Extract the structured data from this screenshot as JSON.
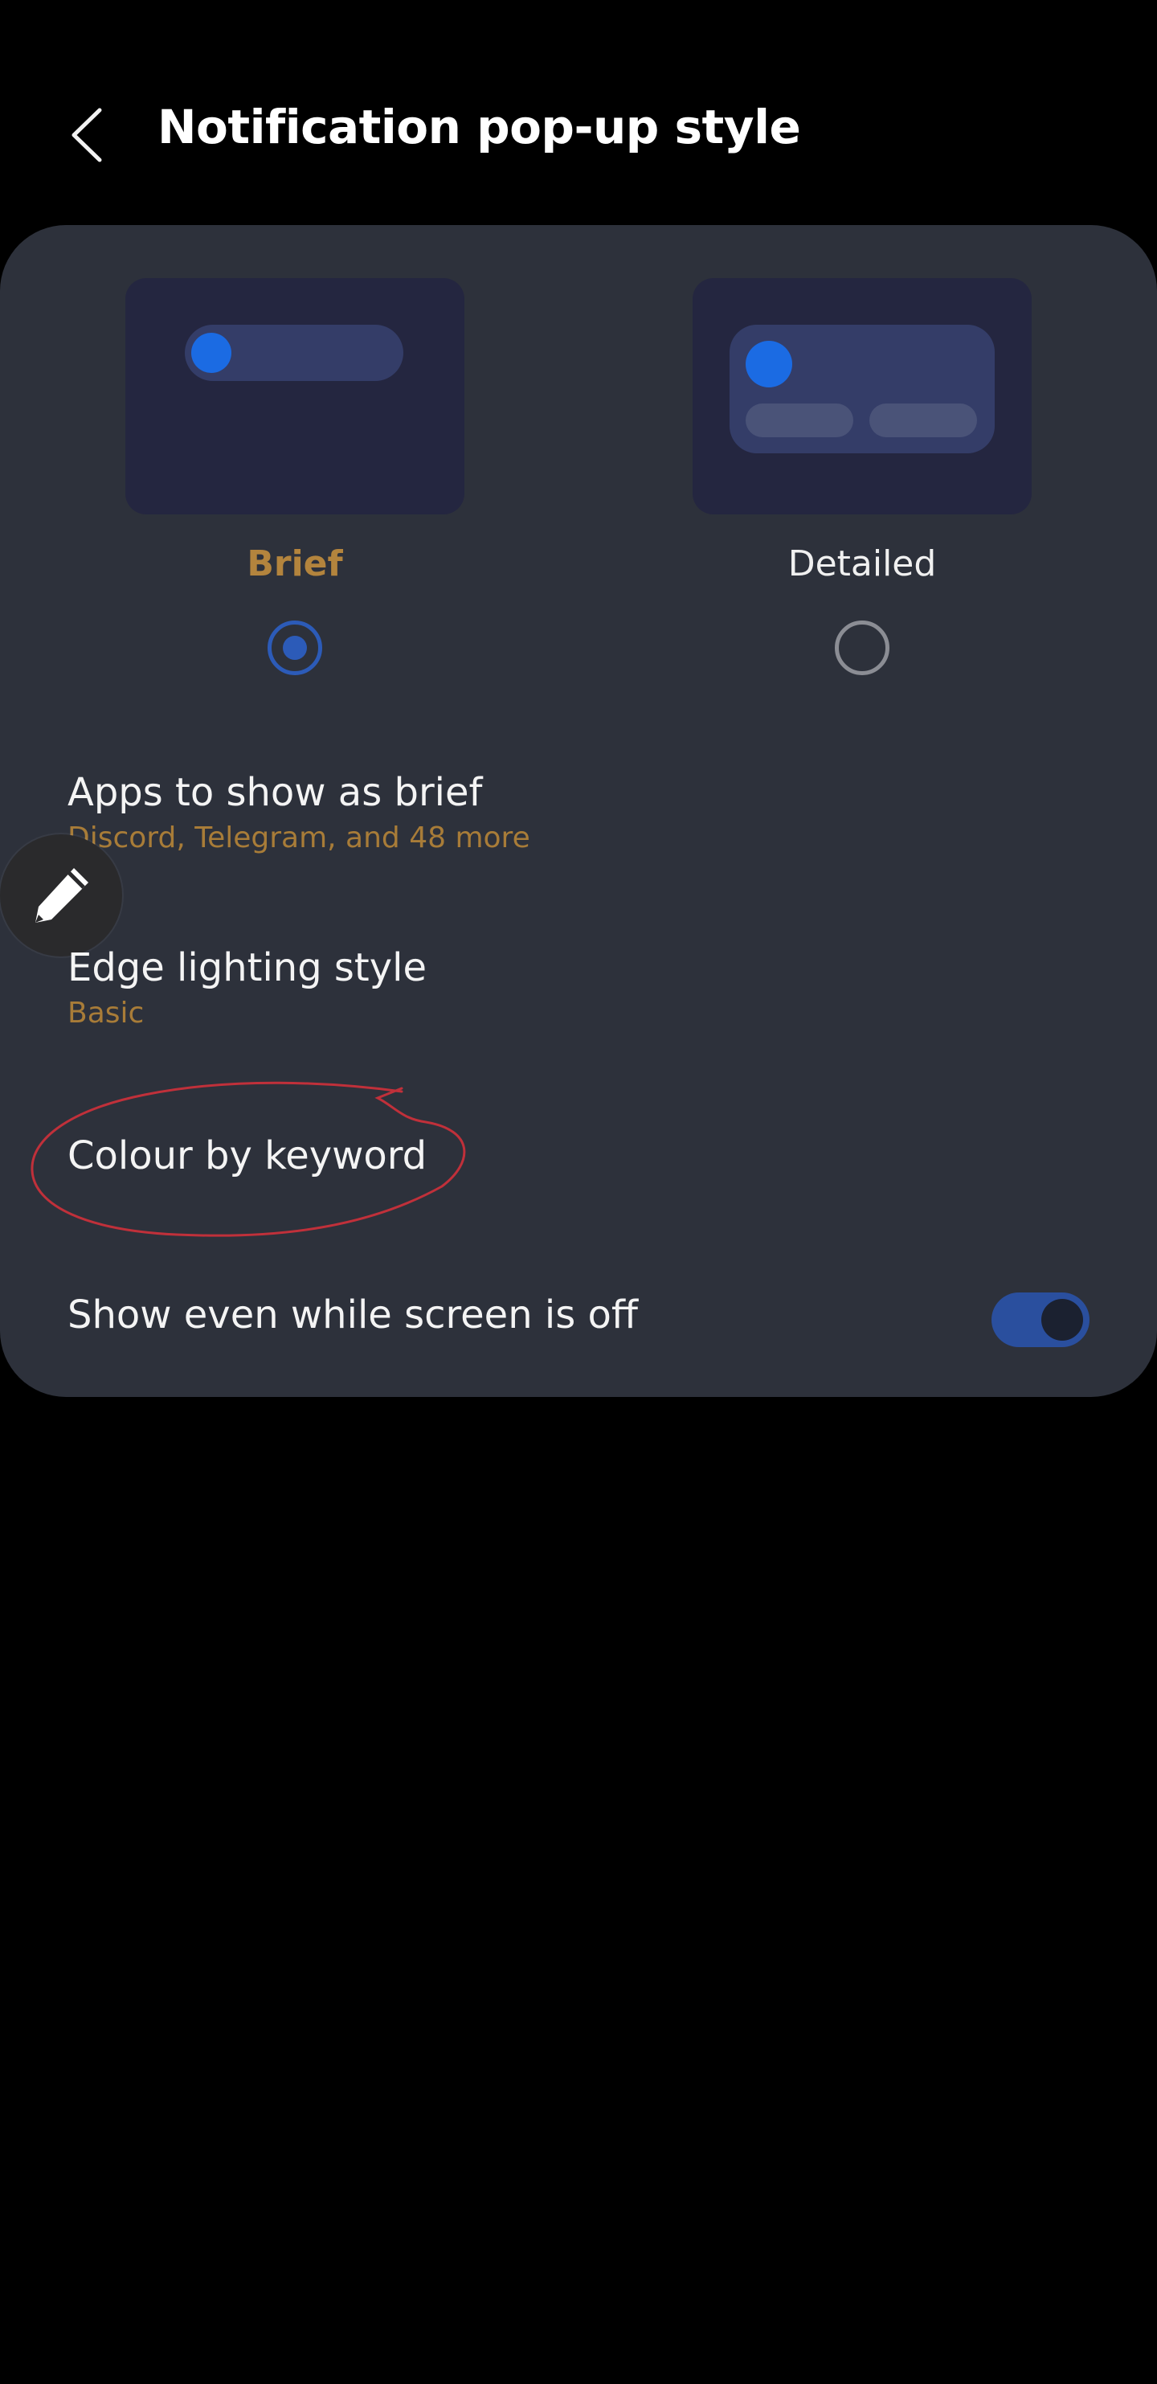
{
  "header": {
    "title": "Notification pop-up style",
    "back_icon": "chevron-left-icon"
  },
  "style_options": [
    {
      "label": "Brief",
      "selected": true
    },
    {
      "label": "Detailed",
      "selected": false
    }
  ],
  "settings": {
    "apps_brief": {
      "title": "Apps to show as brief",
      "subtitle": "Discord, Telegram, and 48 more"
    },
    "edge_lighting": {
      "title": "Edge lighting style",
      "subtitle": "Basic"
    },
    "colour_keyword": {
      "title": "Colour by keyword"
    },
    "screen_off": {
      "title": "Show even while screen is off",
      "enabled": true
    }
  },
  "colors": {
    "accent": "#b3843d",
    "toggle_on": "#2a4f9e",
    "card_bg": "#2d313b",
    "annotation": "#c0303a"
  },
  "floating_button": {
    "icon": "pencil-icon"
  }
}
